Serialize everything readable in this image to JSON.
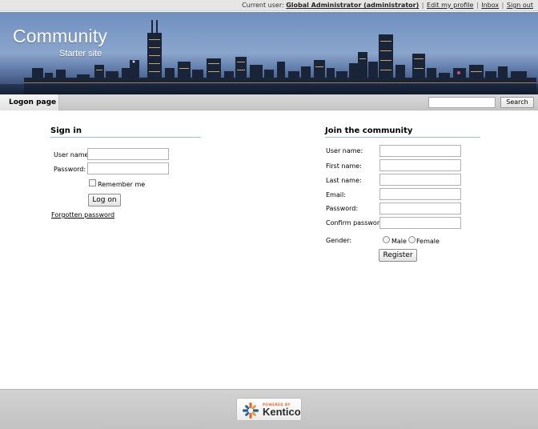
{
  "header": {
    "current_user_label": "Current user:",
    "user_name": "Global Administrator (administrator)",
    "links": {
      "edit_profile": "Edit my profile",
      "inbox": "Inbox",
      "sign_out": "Sign out"
    },
    "separator": "|"
  },
  "banner": {
    "title": "Community",
    "subtitle": "Starter site"
  },
  "nav": {
    "active_tab": "Logon page",
    "search": {
      "value": "",
      "button_label": "Search"
    }
  },
  "sign_in": {
    "title": "Sign in",
    "username_label": "User name:",
    "password_label": "Password:",
    "remember_me": "Remember me",
    "remember_checked": false,
    "logon_button": "Log on",
    "forgotten_link": "Forgotten password"
  },
  "join": {
    "title": "Join the community",
    "fields": {
      "username": "User name:",
      "first_name": "First name:",
      "last_name": "Last name:",
      "email": "Email:",
      "password": "Password:",
      "confirm_password": "Confirm password:"
    },
    "gender_label": "Gender:",
    "gender_male": "Male",
    "gender_female": "Female",
    "register_button": "Register"
  },
  "footer": {
    "powered_by": "POWERED BY",
    "brand": "Kentico"
  },
  "colors": {
    "section_rule": "#8fc6e4",
    "kentico_orange": "#f26522",
    "kentico_blue": "#1f5fa8"
  }
}
